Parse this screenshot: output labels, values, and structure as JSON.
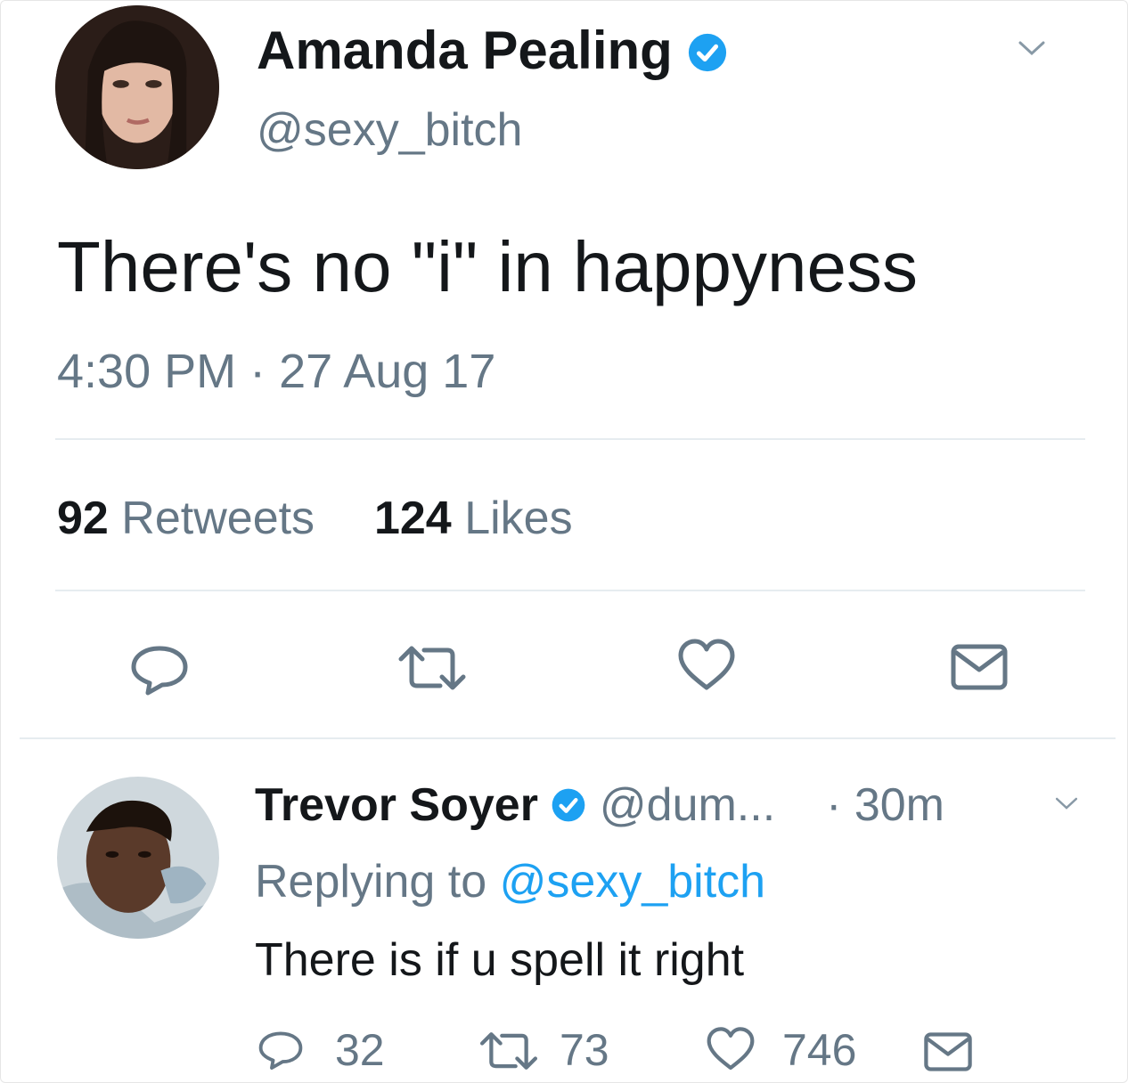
{
  "tweet": {
    "author_name": "Amanda Pealing",
    "author_handle": "@sexy_bitch",
    "text": "There's no \"i\" in happyness",
    "time": "4:30 PM",
    "separator": "·",
    "date": "27 Aug 17",
    "retweets_count": "92",
    "retweets_label": "Retweets",
    "likes_count": "124",
    "likes_label": "Likes",
    "actions": [
      "reply-icon",
      "retweet-icon",
      "like-icon",
      "message-icon"
    ]
  },
  "reply": {
    "author_name": "Trevor Soyer",
    "author_handle": "@dum...",
    "time": "· 30m",
    "replying_prefix": "Replying to",
    "replying_handle": "@sexy_bitch",
    "text": "There is if u spell it right",
    "reply_count": "32",
    "retweet_count": "73",
    "like_count": "746"
  },
  "colors": {
    "verified": "#1da1f2",
    "link": "#1da1f2",
    "muted": "#657786",
    "divider": "#e6ecf0"
  }
}
